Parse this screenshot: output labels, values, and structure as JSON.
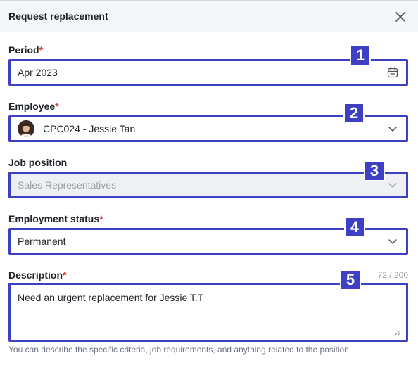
{
  "dialog": {
    "title": "Request replacement"
  },
  "fields": {
    "period": {
      "label": "Period",
      "required_mark": "*",
      "value": "Apr 2023",
      "badge": "1"
    },
    "employee": {
      "label": "Employee",
      "required_mark": "*",
      "value": "CPC024 - Jessie Tan",
      "badge": "2"
    },
    "job_position": {
      "label": "Job position",
      "value": "Sales Representatives",
      "badge": "3"
    },
    "employment_status": {
      "label": "Employment status",
      "required_mark": "*",
      "value": "Permanent",
      "badge": "4"
    },
    "description": {
      "label": "Description",
      "required_mark": "*",
      "value": "Need an urgent replacement for Jessie T.T",
      "counter": "72 / 200",
      "badge": "5",
      "helper": "You can describe the specific criteria, job requirements, and anything related to the position."
    }
  },
  "colors": {
    "accent": "#3d3fc4",
    "required": "#d93b3b"
  }
}
